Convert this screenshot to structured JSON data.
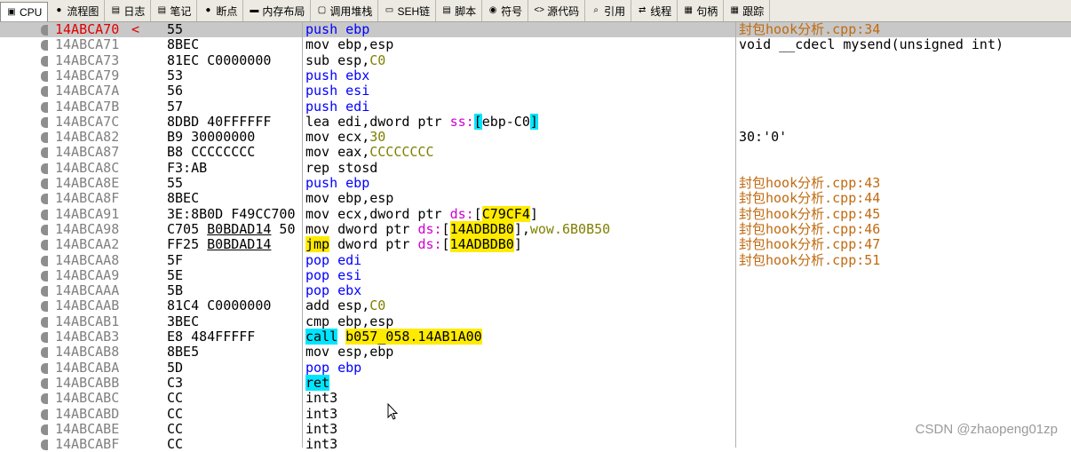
{
  "tabs": [
    {
      "label": "CPU",
      "icon": "cpu-icon",
      "glyph": "▣",
      "active": true
    },
    {
      "label": "流程图",
      "icon": "globe-icon",
      "glyph": "●"
    },
    {
      "label": "日志",
      "icon": "log-icon",
      "glyph": "▤"
    },
    {
      "label": "笔记",
      "icon": "notes-icon",
      "glyph": "▤"
    },
    {
      "label": "断点",
      "icon": "breakpoint-icon",
      "glyph": "●"
    },
    {
      "label": "内存布局",
      "icon": "memory-icon",
      "glyph": "▬"
    },
    {
      "label": "调用堆栈",
      "icon": "callstack-icon",
      "glyph": "▢"
    },
    {
      "label": "SEH链",
      "icon": "seh-icon",
      "glyph": "▭"
    },
    {
      "label": "脚本",
      "icon": "script-icon",
      "glyph": "▤"
    },
    {
      "label": "符号",
      "icon": "symbols-icon",
      "glyph": "◉"
    },
    {
      "label": "源代码",
      "icon": "source-icon",
      "glyph": "<>"
    },
    {
      "label": "引用",
      "icon": "search-icon",
      "glyph": "⌕"
    },
    {
      "label": "线程",
      "icon": "thread-icon",
      "glyph": "⇄"
    },
    {
      "label": "句柄",
      "icon": "handles-icon",
      "glyph": "▦"
    },
    {
      "label": "跟踪",
      "icon": "trace-icon",
      "glyph": "▦"
    }
  ],
  "rows": [
    {
      "addr": "14ABCA70",
      "bytes": "55",
      "current": true,
      "arrow": "<",
      "dis": [
        {
          "t": "push ebp",
          "c": "kw-blue"
        }
      ],
      "comment": "封包hook分析.cpp:34",
      "src": true
    },
    {
      "addr": "14ABCA71",
      "bytes": "8BEC",
      "dis": [
        {
          "t": "mov ebp,esp"
        }
      ],
      "comment": "void __cdecl mysend(unsigned int)"
    },
    {
      "addr": "14ABCA73",
      "bytes": "81EC C0000000",
      "dis": [
        {
          "t": "sub esp,"
        },
        {
          "t": "C0",
          "c": "imm"
        }
      ]
    },
    {
      "addr": "14ABCA79",
      "bytes": "53",
      "dis": [
        {
          "t": "push ebx",
          "c": "kw-blue"
        }
      ]
    },
    {
      "addr": "14ABCA7A",
      "bytes": "56",
      "dis": [
        {
          "t": "push esi",
          "c": "kw-blue"
        }
      ]
    },
    {
      "addr": "14ABCA7B",
      "bytes": "57",
      "dis": [
        {
          "t": "push edi",
          "c": "kw-blue"
        }
      ]
    },
    {
      "addr": "14ABCA7C",
      "bytes": "8DBD 40FFFFFF",
      "dis": [
        {
          "t": "lea edi,dword ptr "
        },
        {
          "t": "ss:",
          "c": "seg"
        },
        {
          "t": "[",
          "c": "hl-cyan"
        },
        {
          "t": "ebp-C0"
        },
        {
          "t": "]",
          "c": "hl-cyan"
        }
      ]
    },
    {
      "addr": "14ABCA82",
      "bytes": "B9 30000000",
      "dis": [
        {
          "t": "mov ecx,"
        },
        {
          "t": "30",
          "c": "imm"
        }
      ],
      "comment": "30:'0'"
    },
    {
      "addr": "14ABCA87",
      "bytes": "B8 CCCCCCCC",
      "dis": [
        {
          "t": "mov eax,"
        },
        {
          "t": "CCCCCCCC",
          "c": "imm"
        }
      ]
    },
    {
      "addr": "14ABCA8C",
      "bytes": "F3:AB",
      "dis": [
        {
          "t": "rep stosd"
        }
      ]
    },
    {
      "addr": "14ABCA8E",
      "bytes": "55",
      "dis": [
        {
          "t": "push ebp",
          "c": "kw-blue"
        }
      ],
      "comment": "封包hook分析.cpp:43",
      "src": true
    },
    {
      "addr": "14ABCA8F",
      "bytes": "8BEC",
      "dis": [
        {
          "t": "mov ebp,esp"
        }
      ],
      "comment": "封包hook分析.cpp:44",
      "src": true
    },
    {
      "addr": "14ABCA91",
      "bytes": "3E:8B0D F49CC700",
      "dis": [
        {
          "t": "mov ecx,dword ptr "
        },
        {
          "t": "ds:",
          "c": "seg"
        },
        {
          "t": "["
        },
        {
          "t": "C79CF4",
          "c": "hl-yellow"
        },
        {
          "t": "]"
        }
      ],
      "comment": "封包hook分析.cpp:45",
      "src": true
    },
    {
      "addr": "14ABCA98",
      "bytes": "C705 B0BDAD14 50",
      "ul": "B0BDAD14",
      "dis": [
        {
          "t": "mov dword ptr "
        },
        {
          "t": "ds:",
          "c": "seg"
        },
        {
          "t": "["
        },
        {
          "t": "14ADBDB0",
          "c": "hl-yellow"
        },
        {
          "t": "],"
        },
        {
          "t": "wow.6B0B50",
          "c": "imm"
        }
      ],
      "comment": "封包hook分析.cpp:46",
      "src": true
    },
    {
      "addr": "14ABCAA2",
      "bytes": "FF25 B0BDAD14",
      "ul": "B0BDAD14",
      "dis": [
        {
          "t": "jmp",
          "c": "hl-yellow"
        },
        {
          "t": " dword ptr "
        },
        {
          "t": "ds:",
          "c": "seg"
        },
        {
          "t": "["
        },
        {
          "t": "14ADBDB0",
          "c": "hl-yellow"
        },
        {
          "t": "]"
        }
      ],
      "comment": "封包hook分析.cpp:47",
      "src": true
    },
    {
      "addr": "14ABCAA8",
      "bytes": "5F",
      "dis": [
        {
          "t": "pop edi",
          "c": "kw-blue"
        }
      ],
      "comment": "封包hook分析.cpp:51",
      "src": true
    },
    {
      "addr": "14ABCAA9",
      "bytes": "5E",
      "dis": [
        {
          "t": "pop esi",
          "c": "kw-blue"
        }
      ]
    },
    {
      "addr": "14ABCAAA",
      "bytes": "5B",
      "dis": [
        {
          "t": "pop ebx",
          "c": "kw-blue"
        }
      ]
    },
    {
      "addr": "14ABCAAB",
      "bytes": "81C4 C0000000",
      "dis": [
        {
          "t": "add esp,"
        },
        {
          "t": "C0",
          "c": "imm"
        }
      ]
    },
    {
      "addr": "14ABCAB1",
      "bytes": "3BEC",
      "dis": [
        {
          "t": "cmp ebp,esp"
        }
      ]
    },
    {
      "addr": "14ABCAB3",
      "bytes": "E8 484FFFFF",
      "dis": [
        {
          "t": "call",
          "c": "hl-cyan"
        },
        {
          "t": " "
        },
        {
          "t": "b057_058.14AB1A00",
          "c": "hl-yellow"
        }
      ]
    },
    {
      "addr": "14ABCAB8",
      "bytes": "8BE5",
      "dis": [
        {
          "t": "mov esp,ebp"
        }
      ]
    },
    {
      "addr": "14ABCABA",
      "bytes": "5D",
      "dis": [
        {
          "t": "pop ebp",
          "c": "kw-blue"
        }
      ]
    },
    {
      "addr": "14ABCABB",
      "bytes": "C3",
      "dis": [
        {
          "t": "ret",
          "c": "hl-cyan"
        }
      ]
    },
    {
      "addr": "14ABCABC",
      "bytes": "CC",
      "dis": [
        {
          "t": "int3"
        }
      ]
    },
    {
      "addr": "14ABCABD",
      "bytes": "CC",
      "dis": [
        {
          "t": "int3"
        }
      ]
    },
    {
      "addr": "14ABCABE",
      "bytes": "CC",
      "dis": [
        {
          "t": "int3"
        }
      ]
    },
    {
      "addr": "14ABCABF",
      "bytes": "CC",
      "dis": [
        {
          "t": "int3"
        }
      ]
    }
  ],
  "watermark": "CSDN @zhaopeng01zp",
  "colors": {
    "current_row": "#c8c8c8",
    "current_addr": "#e00000",
    "keyword": "#0000ff",
    "highlight_cyan": "#00e5ff",
    "highlight_yellow": "#ffeb00",
    "segment": "#d000d0",
    "source_comment": "#c06a10"
  }
}
